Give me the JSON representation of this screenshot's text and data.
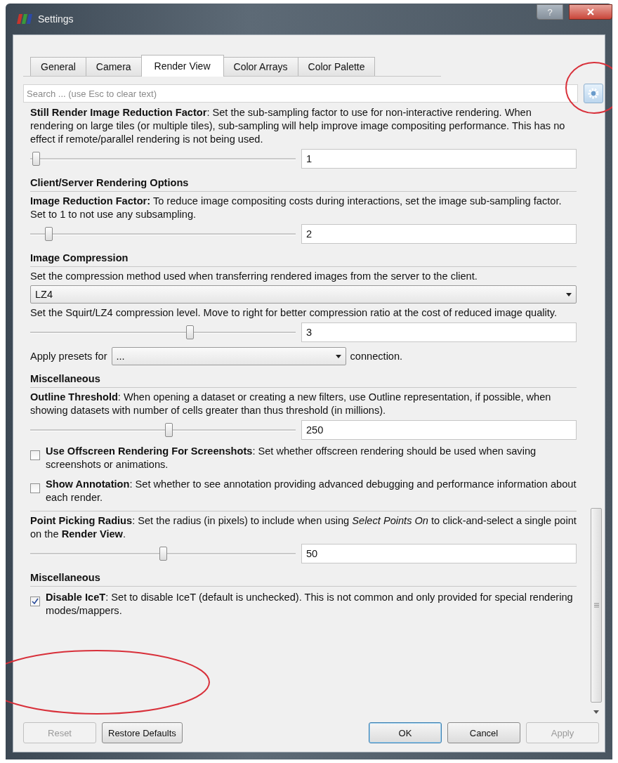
{
  "window": {
    "title": "Settings",
    "help_button": "?"
  },
  "tabs": [
    {
      "label": "General",
      "selected": false
    },
    {
      "label": "Camera",
      "selected": false
    },
    {
      "label": "Render View",
      "selected": true
    },
    {
      "label": "Color Arrays",
      "selected": false
    },
    {
      "label": "Color Palette",
      "selected": false
    }
  ],
  "search": {
    "placeholder": "Search ... (use Esc to clear text)"
  },
  "items": [
    {
      "kind": "slider",
      "text": "**Still Render Image Reduction Factor**: Set the sub-sampling factor to use for non-interactive rendering. When rendering on large tiles (or multiple tiles), sub-sampling will help improve image compositing performance. This has no effect if remote/parallel rendering is not being used.",
      "level": 0.02,
      "value": "1"
    },
    {
      "kind": "heading",
      "text": "**Client/Server Rendering Options**"
    },
    {
      "kind": "slider",
      "text": "**Image Reduction Factor:** To reduce image compositing costs during interactions, set the image sub-sampling factor. Set to 1 to not use any subsampling.",
      "level": 0.07,
      "value": "2"
    },
    {
      "kind": "heading",
      "text": "**Image Compression**"
    },
    {
      "kind": "text",
      "text": "Set the compression method used when transferring rendered images from the server to the client."
    },
    {
      "kind": "combo",
      "value": "LZ4"
    },
    {
      "kind": "slider",
      "text": "Set the Squirt/LZ4 compression level. Move to right for better compression ratio at the cost of reduced image quality.",
      "level": 0.6,
      "value": "3"
    },
    {
      "kind": "preset",
      "prefix": "Apply presets for",
      "value": "...",
      "suffix": "connection."
    },
    {
      "kind": "heading",
      "text": "**Miscellaneous**"
    },
    {
      "kind": "slider",
      "text": "**Outline Threshold**: When opening a dataset or creating a new filters, use Outline representation, if possible, when showing datasets with number of cells greater than thus threshold (in millions).",
      "level": 0.52,
      "value": "250"
    },
    {
      "kind": "checkbox",
      "text": "**Use Offscreen Rendering For Screenshots**: Set whether offscreen rendering should be used when saving screenshots or animations.",
      "checked": false
    },
    {
      "kind": "checkbox",
      "text": "**Show Annotation**: Set whether to see annotation providing advanced debugging and performance information about each render.",
      "checked": false
    },
    {
      "kind": "separator"
    },
    {
      "kind": "slider",
      "text": "**Point Picking Radius**: Set the radius (in pixels) to include when using *Select Points On* to click-and-select a single point on the **Render View**.",
      "level": 0.5,
      "value": "50"
    },
    {
      "kind": "heading",
      "text": "**Miscellaneous**"
    },
    {
      "kind": "checkbox",
      "text": "**Disable IceT**: Set to disable IceT (default is unchecked). This is not common and only provided for special rendering modes/mappers.",
      "checked": true
    }
  ],
  "buttons": [
    {
      "label": "Reset",
      "disabled": true,
      "default": false
    },
    {
      "label": "Restore Defaults",
      "disabled": false,
      "default": false
    },
    {
      "label": "OK",
      "disabled": false,
      "default": true
    },
    {
      "label": "Cancel",
      "disabled": false,
      "default": false
    },
    {
      "label": "Apply",
      "disabled": true,
      "default": false
    }
  ]
}
